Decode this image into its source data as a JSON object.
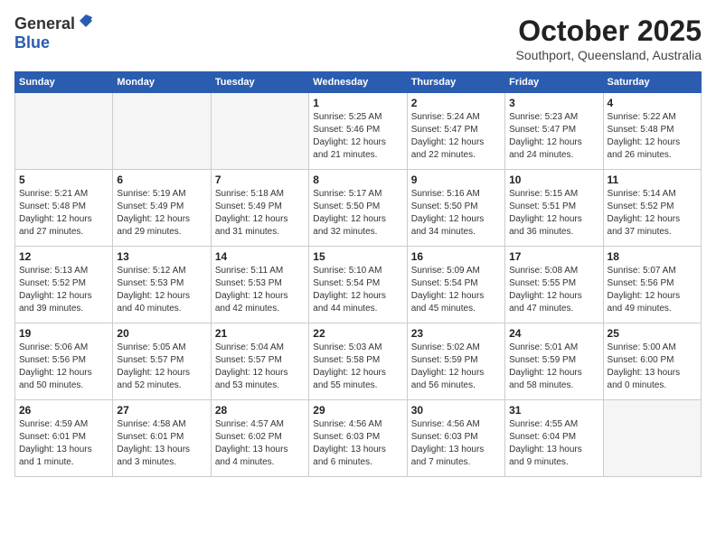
{
  "header": {
    "logo_general": "General",
    "logo_blue": "Blue",
    "month": "October 2025",
    "location": "Southport, Queensland, Australia"
  },
  "days_of_week": [
    "Sunday",
    "Monday",
    "Tuesday",
    "Wednesday",
    "Thursday",
    "Friday",
    "Saturday"
  ],
  "weeks": [
    [
      {
        "day": "",
        "info": ""
      },
      {
        "day": "",
        "info": ""
      },
      {
        "day": "",
        "info": ""
      },
      {
        "day": "1",
        "info": "Sunrise: 5:25 AM\nSunset: 5:46 PM\nDaylight: 12 hours\nand 21 minutes."
      },
      {
        "day": "2",
        "info": "Sunrise: 5:24 AM\nSunset: 5:47 PM\nDaylight: 12 hours\nand 22 minutes."
      },
      {
        "day": "3",
        "info": "Sunrise: 5:23 AM\nSunset: 5:47 PM\nDaylight: 12 hours\nand 24 minutes."
      },
      {
        "day": "4",
        "info": "Sunrise: 5:22 AM\nSunset: 5:48 PM\nDaylight: 12 hours\nand 26 minutes."
      }
    ],
    [
      {
        "day": "5",
        "info": "Sunrise: 5:21 AM\nSunset: 5:48 PM\nDaylight: 12 hours\nand 27 minutes."
      },
      {
        "day": "6",
        "info": "Sunrise: 5:19 AM\nSunset: 5:49 PM\nDaylight: 12 hours\nand 29 minutes."
      },
      {
        "day": "7",
        "info": "Sunrise: 5:18 AM\nSunset: 5:49 PM\nDaylight: 12 hours\nand 31 minutes."
      },
      {
        "day": "8",
        "info": "Sunrise: 5:17 AM\nSunset: 5:50 PM\nDaylight: 12 hours\nand 32 minutes."
      },
      {
        "day": "9",
        "info": "Sunrise: 5:16 AM\nSunset: 5:50 PM\nDaylight: 12 hours\nand 34 minutes."
      },
      {
        "day": "10",
        "info": "Sunrise: 5:15 AM\nSunset: 5:51 PM\nDaylight: 12 hours\nand 36 minutes."
      },
      {
        "day": "11",
        "info": "Sunrise: 5:14 AM\nSunset: 5:52 PM\nDaylight: 12 hours\nand 37 minutes."
      }
    ],
    [
      {
        "day": "12",
        "info": "Sunrise: 5:13 AM\nSunset: 5:52 PM\nDaylight: 12 hours\nand 39 minutes."
      },
      {
        "day": "13",
        "info": "Sunrise: 5:12 AM\nSunset: 5:53 PM\nDaylight: 12 hours\nand 40 minutes."
      },
      {
        "day": "14",
        "info": "Sunrise: 5:11 AM\nSunset: 5:53 PM\nDaylight: 12 hours\nand 42 minutes."
      },
      {
        "day": "15",
        "info": "Sunrise: 5:10 AM\nSunset: 5:54 PM\nDaylight: 12 hours\nand 44 minutes."
      },
      {
        "day": "16",
        "info": "Sunrise: 5:09 AM\nSunset: 5:54 PM\nDaylight: 12 hours\nand 45 minutes."
      },
      {
        "day": "17",
        "info": "Sunrise: 5:08 AM\nSunset: 5:55 PM\nDaylight: 12 hours\nand 47 minutes."
      },
      {
        "day": "18",
        "info": "Sunrise: 5:07 AM\nSunset: 5:56 PM\nDaylight: 12 hours\nand 49 minutes."
      }
    ],
    [
      {
        "day": "19",
        "info": "Sunrise: 5:06 AM\nSunset: 5:56 PM\nDaylight: 12 hours\nand 50 minutes."
      },
      {
        "day": "20",
        "info": "Sunrise: 5:05 AM\nSunset: 5:57 PM\nDaylight: 12 hours\nand 52 minutes."
      },
      {
        "day": "21",
        "info": "Sunrise: 5:04 AM\nSunset: 5:57 PM\nDaylight: 12 hours\nand 53 minutes."
      },
      {
        "day": "22",
        "info": "Sunrise: 5:03 AM\nSunset: 5:58 PM\nDaylight: 12 hours\nand 55 minutes."
      },
      {
        "day": "23",
        "info": "Sunrise: 5:02 AM\nSunset: 5:59 PM\nDaylight: 12 hours\nand 56 minutes."
      },
      {
        "day": "24",
        "info": "Sunrise: 5:01 AM\nSunset: 5:59 PM\nDaylight: 12 hours\nand 58 minutes."
      },
      {
        "day": "25",
        "info": "Sunrise: 5:00 AM\nSunset: 6:00 PM\nDaylight: 13 hours\nand 0 minutes."
      }
    ],
    [
      {
        "day": "26",
        "info": "Sunrise: 4:59 AM\nSunset: 6:01 PM\nDaylight: 13 hours\nand 1 minute."
      },
      {
        "day": "27",
        "info": "Sunrise: 4:58 AM\nSunset: 6:01 PM\nDaylight: 13 hours\nand 3 minutes."
      },
      {
        "day": "28",
        "info": "Sunrise: 4:57 AM\nSunset: 6:02 PM\nDaylight: 13 hours\nand 4 minutes."
      },
      {
        "day": "29",
        "info": "Sunrise: 4:56 AM\nSunset: 6:03 PM\nDaylight: 13 hours\nand 6 minutes."
      },
      {
        "day": "30",
        "info": "Sunrise: 4:56 AM\nSunset: 6:03 PM\nDaylight: 13 hours\nand 7 minutes."
      },
      {
        "day": "31",
        "info": "Sunrise: 4:55 AM\nSunset: 6:04 PM\nDaylight: 13 hours\nand 9 minutes."
      },
      {
        "day": "",
        "info": ""
      }
    ]
  ]
}
